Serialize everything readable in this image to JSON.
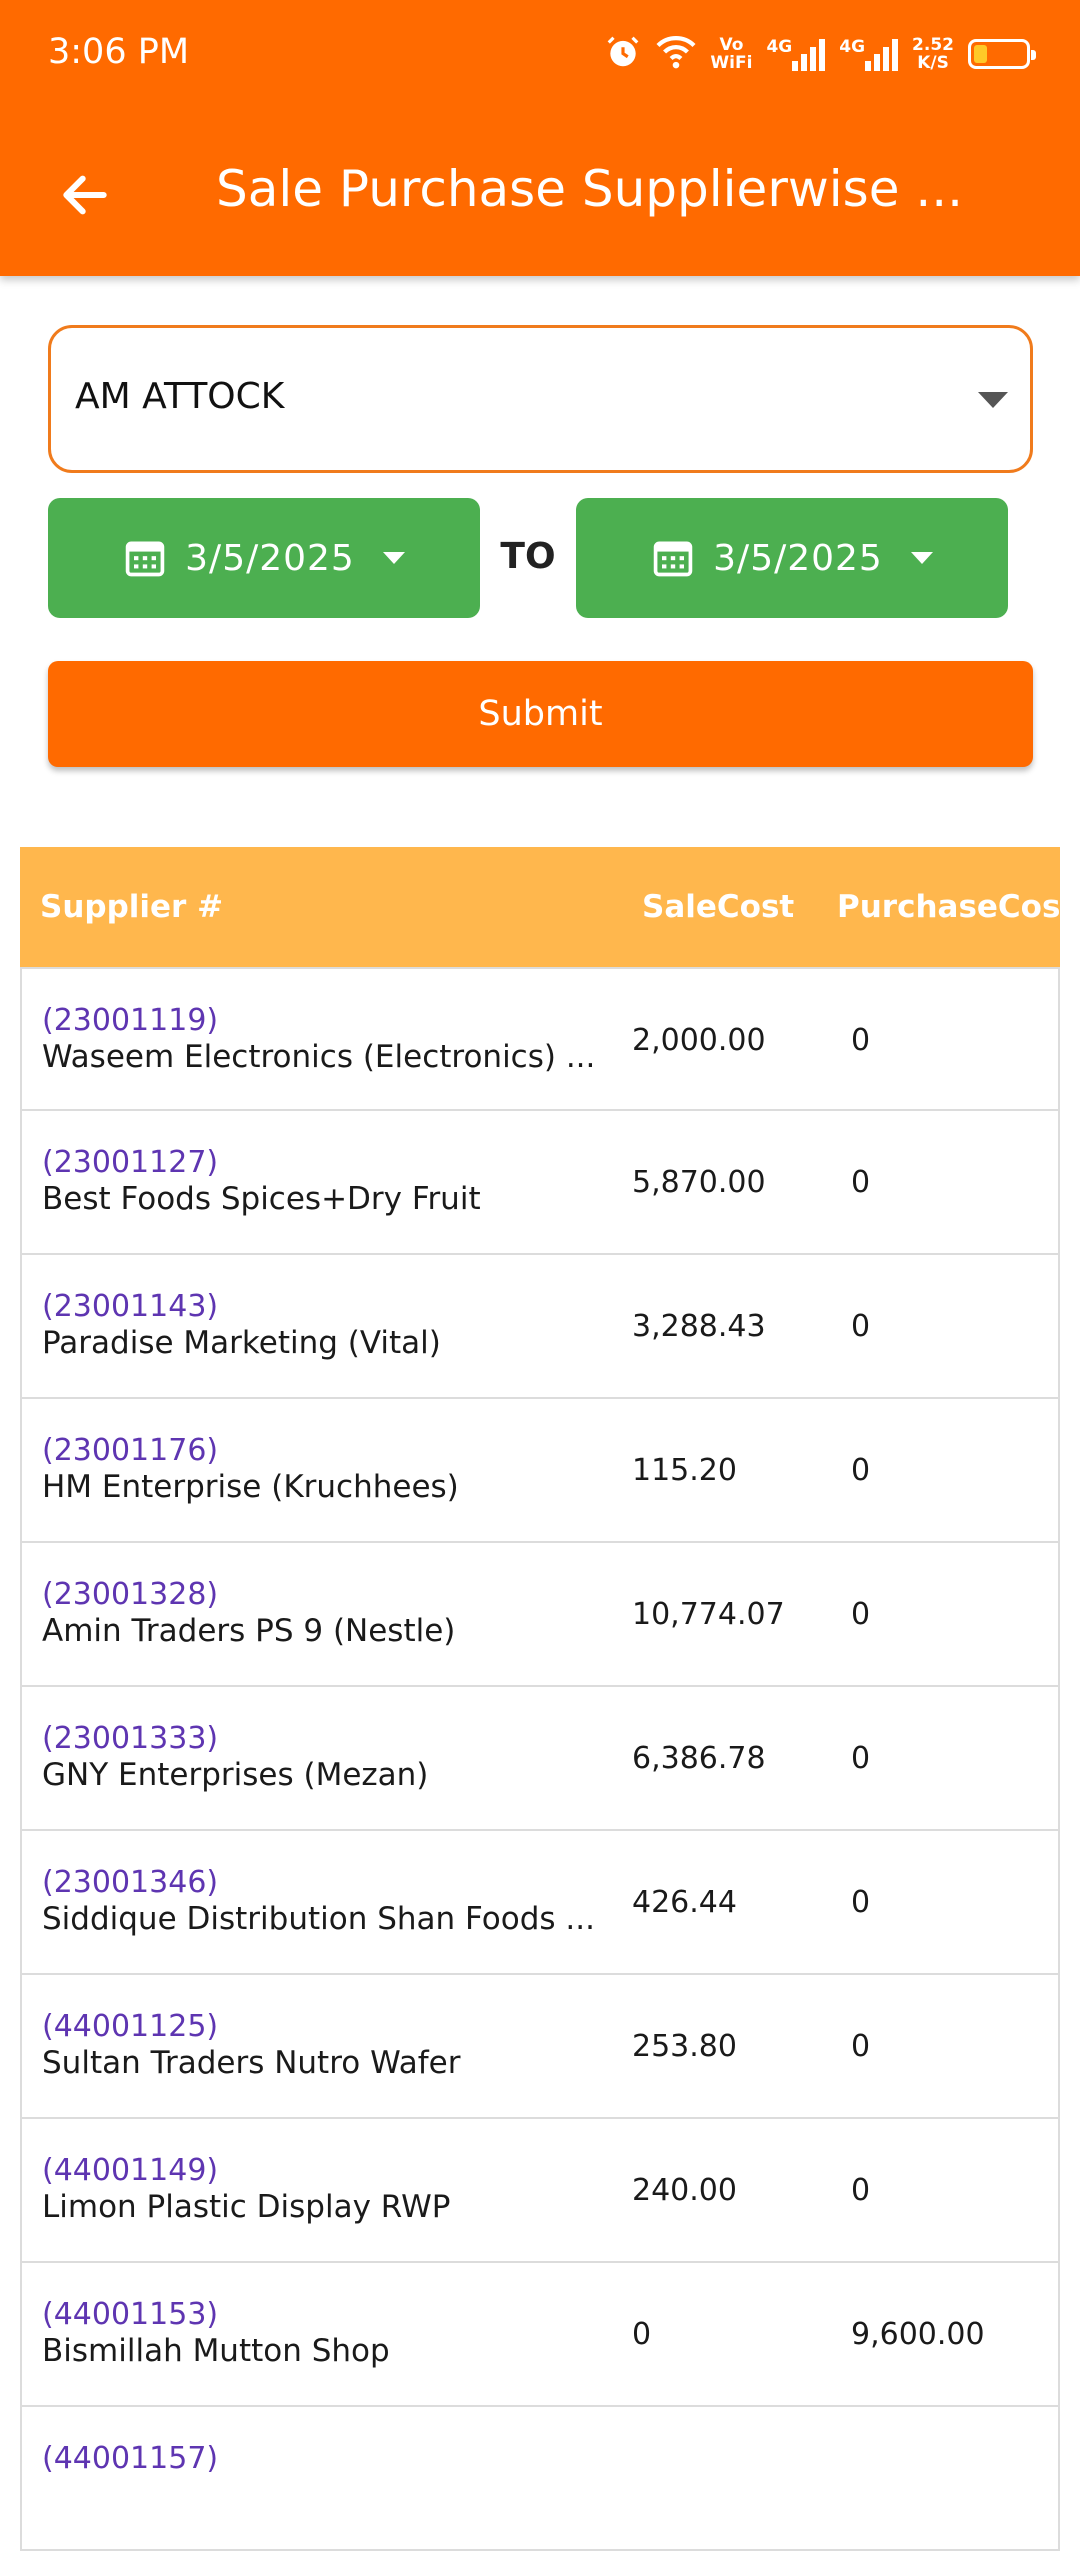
{
  "status_bar": {
    "time": "3:06 PM",
    "volte_label_top": "Vo",
    "volte_label_bottom": "WiFi",
    "network_1": "4G",
    "network_2": "4G",
    "speed_value": "2.52",
    "speed_unit": "K/S",
    "battery_level": 0.18,
    "icons": [
      "alarm-icon",
      "wifi-icon",
      "signal-icon",
      "battery-icon"
    ]
  },
  "header": {
    "title": "Sale Purchase Supplierwise ...",
    "back_icon": "arrow-left-icon",
    "color": "#ff6a00"
  },
  "filters": {
    "supplier_select": "AM ATTOCK",
    "from_date": "3/5/2025",
    "to_label": "TO",
    "to_date": "3/5/2025",
    "submit_label": "Submit"
  },
  "table": {
    "headers": [
      "Supplier #",
      "SaleCost",
      "PurchaseCost"
    ],
    "rows": [
      {
        "code": "(23001119)",
        "name": "Waseem Electronics (Electronics) ...",
        "sale": "2,000.00",
        "purchase": "0"
      },
      {
        "code": "(23001127)",
        "name": "Best Foods Spices+Dry Fruit",
        "sale": "5,870.00",
        "purchase": "0"
      },
      {
        "code": "(23001143)",
        "name": "Paradise Marketing (Vital)",
        "sale": "3,288.43",
        "purchase": "0"
      },
      {
        "code": "(23001176)",
        "name": "HM Enterprise (Kruchhees)",
        "sale": "115.20",
        "purchase": "0"
      },
      {
        "code": "(23001328)",
        "name": "Amin Traders PS 9 (Nestle)",
        "sale": "10,774.07",
        "purchase": "0"
      },
      {
        "code": "(23001333)",
        "name": "GNY Enterprises (Mezan)",
        "sale": "6,386.78",
        "purchase": "0"
      },
      {
        "code": "(23001346)",
        "name": "Siddique Distribution Shan Foods ...",
        "sale": "426.44",
        "purchase": "0"
      },
      {
        "code": "(44001125)",
        "name": "Sultan Traders Nutro Wafer",
        "sale": "253.80",
        "purchase": "0"
      },
      {
        "code": "(44001149)",
        "name": "Limon Plastic Display RWP",
        "sale": "240.00",
        "purchase": "0"
      },
      {
        "code": "(44001153)",
        "name": "Bismillah Mutton Shop",
        "sale": "0",
        "purchase": "9,600.00"
      },
      {
        "code": "(44001157)",
        "name": "",
        "sale": "",
        "purchase": ""
      }
    ]
  },
  "colors": {
    "primary": "#ff6a00",
    "date_button": "#4caf50",
    "table_header": "#ffb74d",
    "supplier_code": "#5e35b1"
  }
}
